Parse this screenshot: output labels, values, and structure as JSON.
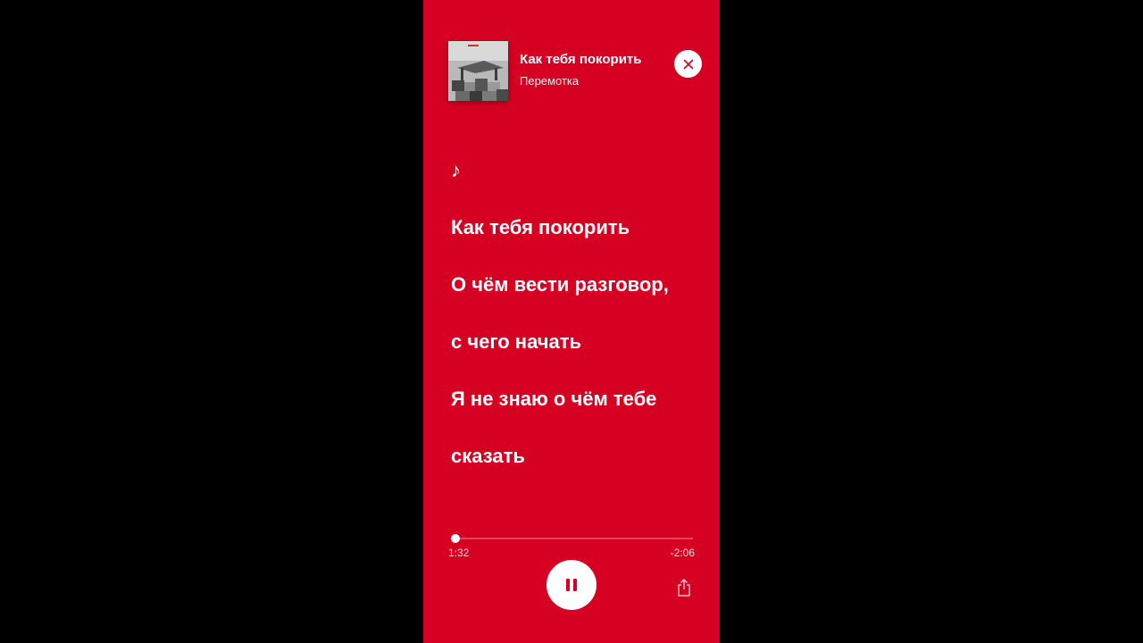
{
  "colors": {
    "background": "#d50022",
    "outer": "#000000",
    "foreground": "#ffffff"
  },
  "track": {
    "title": "Как тебя покорить",
    "artist": "Перемотка",
    "cover_icon": "album-cover"
  },
  "lyrics": {
    "intro_symbol": "♪",
    "lines": [
      "Как тебя покорить",
      "О чём вести разговор,",
      "с чего начать",
      "Я не знаю о чём тебе",
      "сказать"
    ]
  },
  "player": {
    "elapsed": "1:32",
    "remaining": "-2:06",
    "progress": 0.017,
    "state": "playing",
    "pause_icon": "pause-icon",
    "share_icon": "share-icon",
    "close_icon": "close-icon"
  }
}
